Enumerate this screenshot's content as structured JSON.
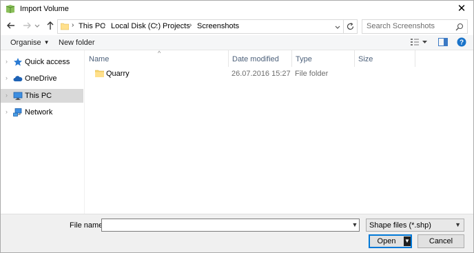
{
  "window": {
    "title": "Import Volume",
    "close_glyph": "✕"
  },
  "address": {
    "breadcrumbs": [
      "This PC",
      "Local Disk (C:)",
      "Projects",
      "Screenshots"
    ],
    "separator": "›"
  },
  "search": {
    "placeholder": "Search Screenshots"
  },
  "toolbar": {
    "organise_label": "Organise",
    "new_folder_label": "New folder",
    "dropdown_glyph": "▼"
  },
  "nav": {
    "chevron": "›",
    "items": [
      {
        "label": "Quick access",
        "icon": "star-icon",
        "selected": false
      },
      {
        "label": "OneDrive",
        "icon": "cloud-icon",
        "selected": false
      },
      {
        "label": "This PC",
        "icon": "computer-icon",
        "selected": true
      },
      {
        "label": "Network",
        "icon": "network-icon",
        "selected": false
      }
    ]
  },
  "columns": {
    "name": "Name",
    "date": "Date modified",
    "type": "Type",
    "size": "Size",
    "sort_glyph": "^"
  },
  "files": [
    {
      "name": "Quarry",
      "date": "26.07.2016 15:27",
      "type": "File folder",
      "size": ""
    }
  ],
  "bottom": {
    "file_name_label": "File name:",
    "file_name_value": "",
    "filter_label": "Shape files (*.shp)",
    "open_label": "Open",
    "cancel_label": "Cancel",
    "arrow_glyph": "▼"
  },
  "colors": {
    "accent": "#0078d7",
    "selection": "#d9d9d9",
    "folder": "#e8c15a",
    "help": "#1a73c9"
  }
}
